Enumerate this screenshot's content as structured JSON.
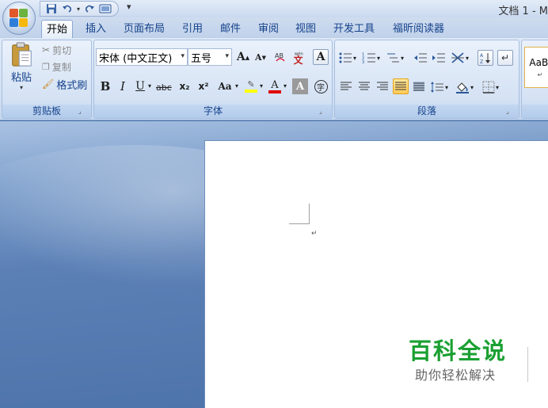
{
  "window": {
    "title": "文档 1 - M"
  },
  "quick_access": {
    "items": [
      "save-icon",
      "undo-icon",
      "redo-icon",
      "print-preview-icon"
    ],
    "more_glyph": "▾"
  },
  "tabs": [
    {
      "label": "开始",
      "active": true
    },
    {
      "label": "插入"
    },
    {
      "label": "页面布局"
    },
    {
      "label": "引用"
    },
    {
      "label": "邮件"
    },
    {
      "label": "审阅"
    },
    {
      "label": "视图"
    },
    {
      "label": "开发工具"
    },
    {
      "label": "福昕阅读器"
    }
  ],
  "clipboard": {
    "group_label": "剪贴板",
    "paste_label": "粘贴",
    "cut_label": "剪切",
    "copy_label": "复制",
    "format_painter_label": "格式刷"
  },
  "font": {
    "group_label": "字体",
    "font_name": "宋体 (中文正文)",
    "font_size": "五号",
    "grow_glyph": "A",
    "shrink_glyph": "A",
    "bold": "B",
    "italic": "I",
    "underline": "U",
    "strike": "abc",
    "subscript": "x₂",
    "superscript": "x²",
    "change_case": "Aa",
    "font_color": "A",
    "char_shading": "A",
    "enclose": "字",
    "highlight_color": "#ffff00",
    "font_color_value": "#e00000"
  },
  "paragraph": {
    "group_label": "段落"
  },
  "styles": {
    "preview": "AaBl",
    "mark": "↵"
  },
  "document": {
    "paragraph_mark": "↵"
  },
  "watermark": {
    "title": "百科全说",
    "subtitle": "助你轻松解决"
  }
}
